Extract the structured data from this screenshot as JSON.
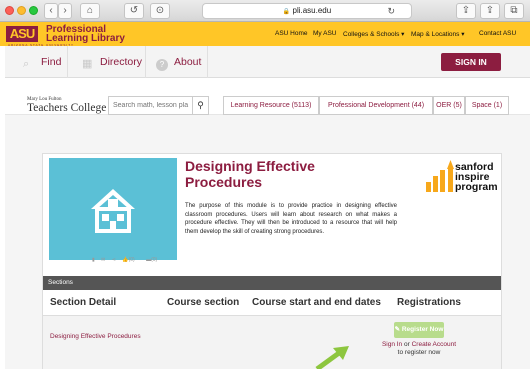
{
  "browser": {
    "url": "pli.asu.edu",
    "lock_icon": "🔒",
    "back": "‹",
    "forward": "›",
    "home": "⌂",
    "history": "↺",
    "extension": "⊙",
    "reload": "↻",
    "share": "⇪",
    "tabs": "⧉"
  },
  "asu_header": {
    "logo": "ASU",
    "title_line1": "Professional",
    "title_line2": "Learning Library",
    "subtitle": "ARIZONA STATE UNIVERSITY",
    "nav": [
      "ASU Home",
      "My ASU",
      "Colleges & Schools ▾",
      "Map & Locations ▾",
      "Contact ASU"
    ]
  },
  "main_nav": {
    "items": [
      {
        "label": "Find",
        "icon": "search-icon"
      },
      {
        "label": "Directory",
        "icon": "grid-icon"
      },
      {
        "label": "About",
        "icon": "question-icon"
      }
    ],
    "signin": "SIGN IN"
  },
  "college": {
    "name_small": "Mary Lou Fulton",
    "name_big": "Teachers College",
    "search_placeholder": "Search math, lesson pla",
    "filters": [
      "Learning Resource (5113)",
      "Professional Development (44)",
      "OER (5)",
      "Space (1)"
    ]
  },
  "module": {
    "title_line1": "Designing Effective",
    "title_line2": "Procedures",
    "description": "The purpose of this module is to provide practice in designing effective classroom procedures. Users will learn about research on what makes a procedure effective. They will then be introduced to a resource that will help them develop the skill of creating strong procedures.",
    "likes": "(0)",
    "comments": "(0)",
    "sponsor_line1": "sanford",
    "sponsor_line2": "inspire",
    "sponsor_line3": "program"
  },
  "sections": {
    "heading": "Sections",
    "columns": [
      "Section Detail",
      "Course section",
      "Course start and end dates",
      "Registrations"
    ],
    "row": {
      "detail": "Designing Effective Procedures",
      "register_button": "Register Now",
      "sign_in": "Sign In",
      "or": " or ",
      "create_account": "Create Account",
      "to_register": "to register now"
    }
  },
  "colors": {
    "asu_gold": "#ffc627",
    "asu_maroon": "#8c1d40",
    "hero_teal": "#5bc0d6",
    "register_green": "#b8dc8c",
    "arrow_green": "#8dc63f"
  }
}
